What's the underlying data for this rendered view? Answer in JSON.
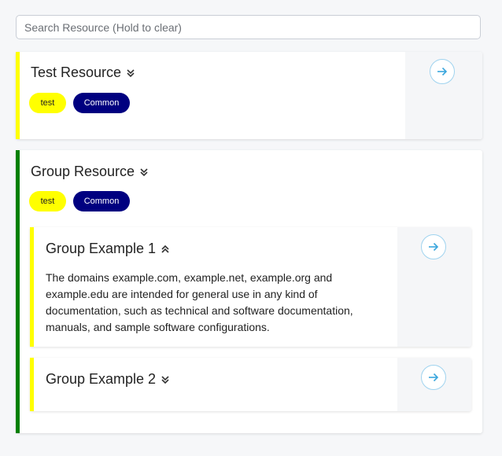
{
  "search": {
    "placeholder": "Search Resource (Hold to clear)"
  },
  "resources": [
    {
      "title": "Test Resource",
      "tags": [
        "test",
        "Common"
      ],
      "accent": "#ffff00",
      "expanded": false
    },
    {
      "title": "Group Resource",
      "tags": [
        "test",
        "Common"
      ],
      "accent": "#008000",
      "children": [
        {
          "title": "Group Example 1",
          "accent": "#ffff00",
          "expanded": true,
          "description": "The domains example.com, example.net, example.org and example.edu are intended for general use in any kind of documentation, such as technical and software documentation, manuals, and sample software configurations."
        },
        {
          "title": "Group Example 2",
          "accent": "#ffff00",
          "expanded": false
        }
      ]
    }
  ],
  "colors": {
    "tag_test": "#ffff00",
    "tag_common": "#000080",
    "arrow": "#3aa6dd"
  },
  "icons": {
    "collapsed": "chevron-double-down-icon",
    "expanded": "chevron-double-up-icon",
    "open": "arrow-right-circle-icon"
  }
}
